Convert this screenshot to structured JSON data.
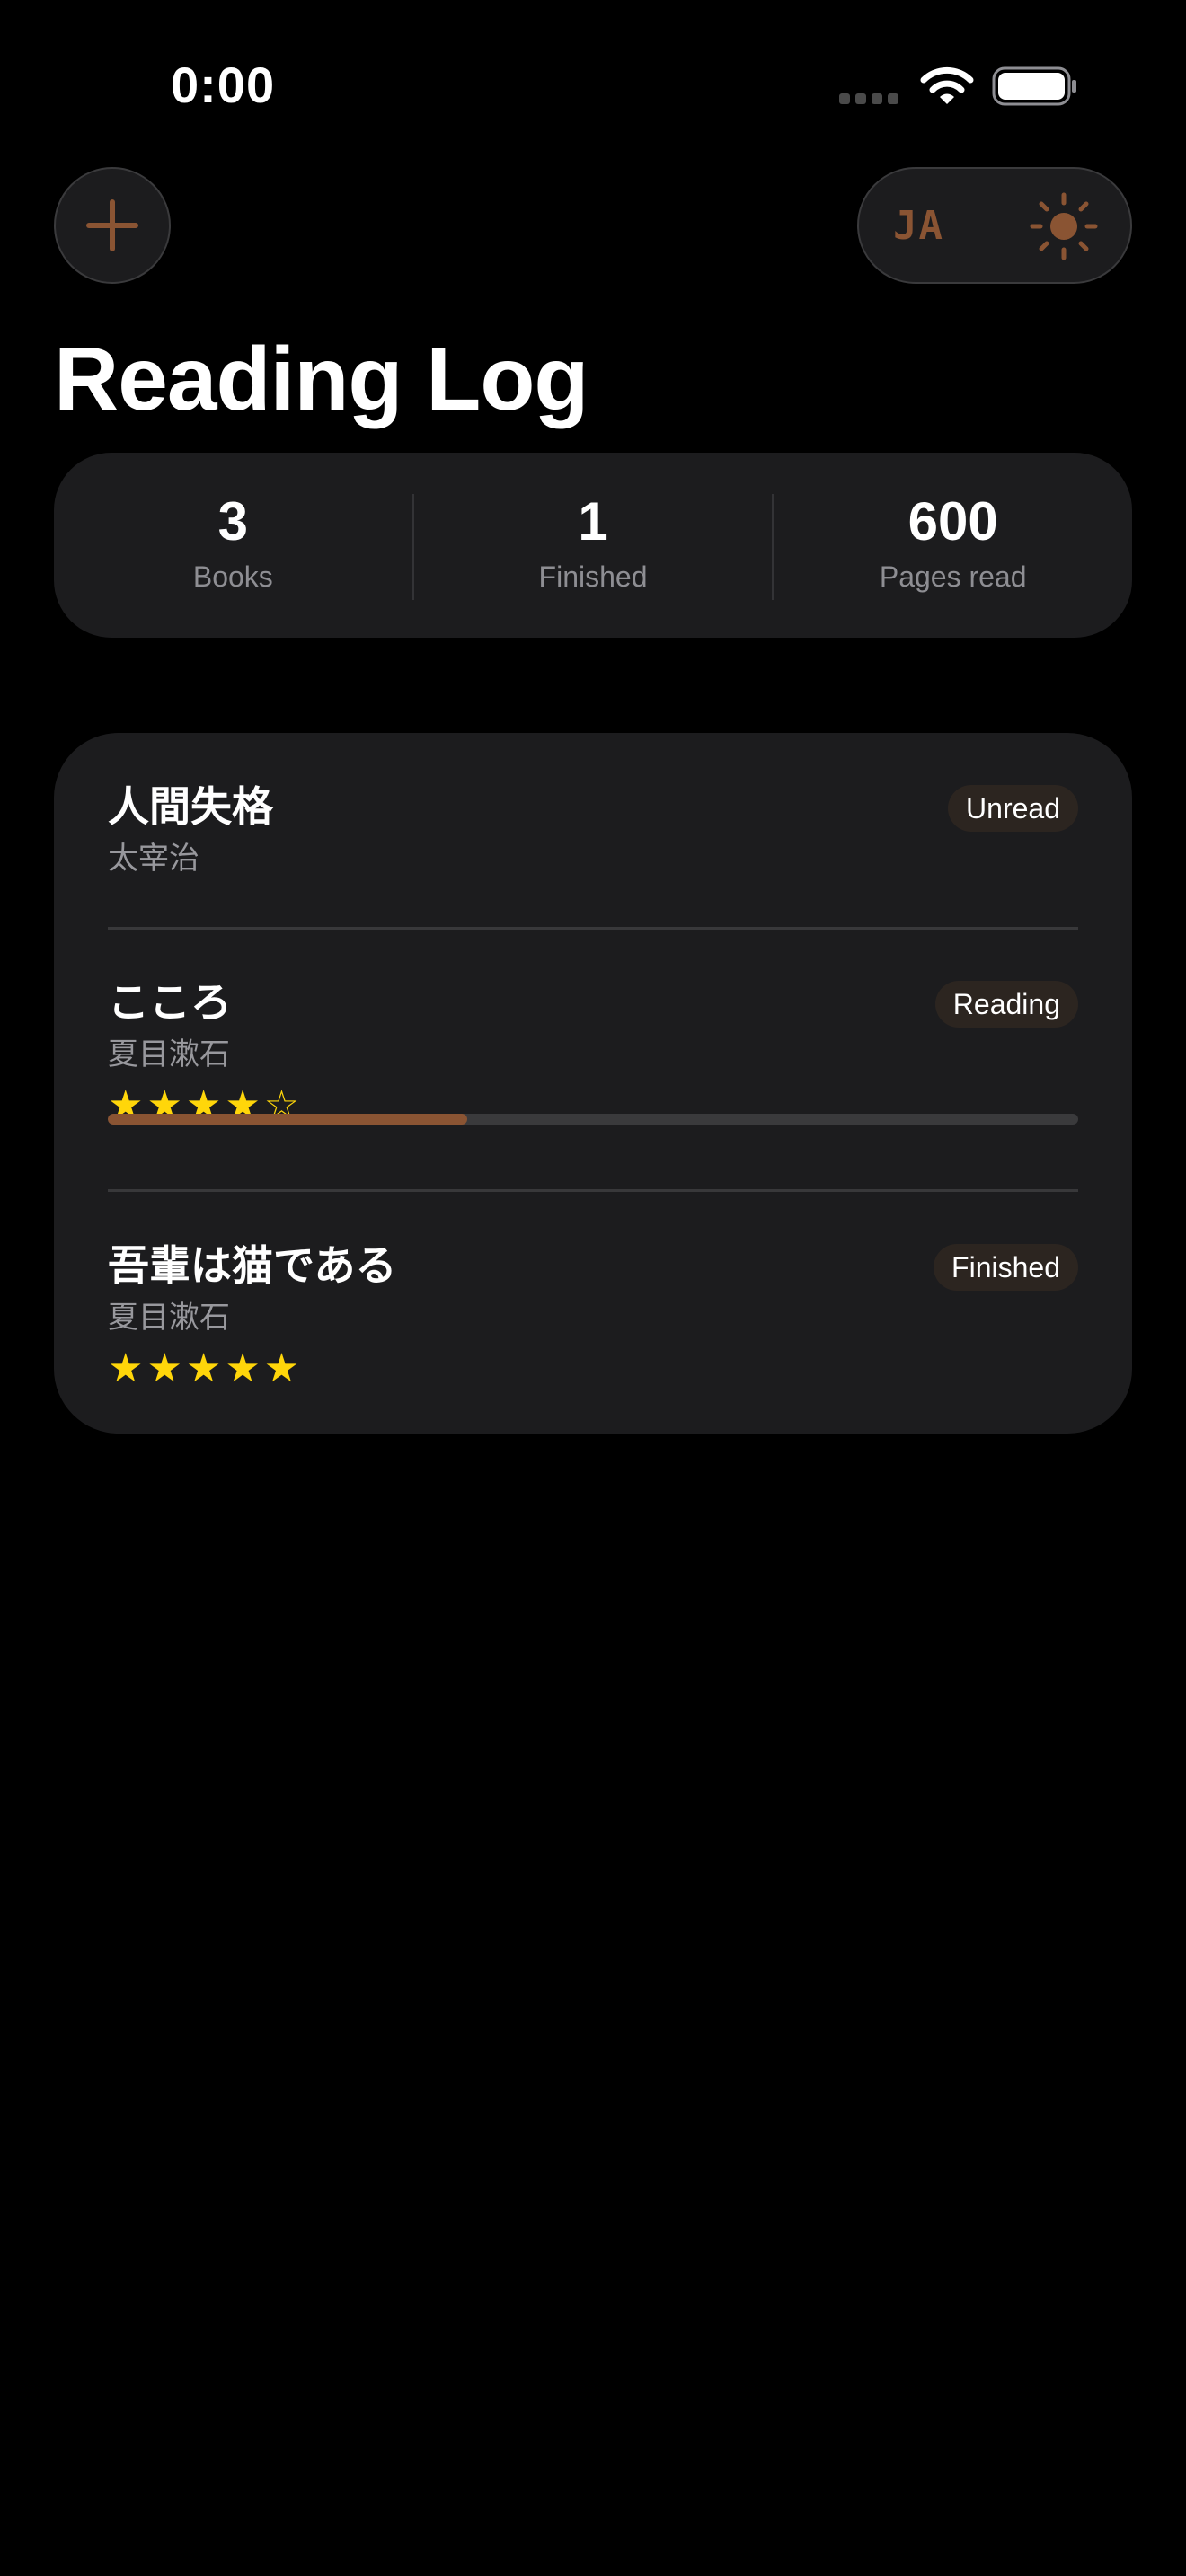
{
  "status_bar": {
    "time": "0:00"
  },
  "toolbar": {
    "add_icon": "plus-icon",
    "language_label": "JA",
    "theme_icon": "sun-icon",
    "accent_color": "#8a5433"
  },
  "page": {
    "title": "Reading Log"
  },
  "stats": [
    {
      "value": "3",
      "label": "Books"
    },
    {
      "value": "1",
      "label": "Finished"
    },
    {
      "value": "600",
      "label": "Pages read"
    }
  ],
  "books": [
    {
      "title": "人間失格",
      "author": "太宰治",
      "status": "Unread"
    },
    {
      "title": "こころ",
      "author": "夏目漱石",
      "status": "Reading",
      "stars": "★★★★☆",
      "rating": 4,
      "progress": 0.37
    },
    {
      "title": "吾輩は猫である",
      "author": "夏目漱石",
      "status": "Finished",
      "stars": "★★★★★",
      "rating": 5
    }
  ],
  "colors": {
    "background": "#000000",
    "card": "#1c1c1e",
    "star": "#ffd60a",
    "progress": "#8a5433"
  }
}
